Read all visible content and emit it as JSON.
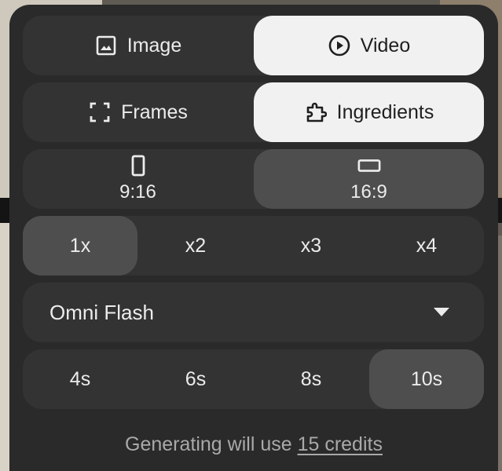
{
  "mode": {
    "image_label": "Image",
    "video_label": "Video",
    "selected": "Video",
    "image_icon": "image-icon",
    "video_icon": "play-circle-icon"
  },
  "input_type": {
    "frames_label": "Frames",
    "ingredients_label": "Ingredients",
    "selected": "Ingredients",
    "frames_icon": "frames-icon",
    "ingredients_icon": "puzzle-icon"
  },
  "aspect_ratio": {
    "portrait_label": "9:16",
    "landscape_label": "16:9",
    "selected": "16:9",
    "portrait_icon": "portrait-rect-icon",
    "landscape_icon": "landscape-rect-icon"
  },
  "count": {
    "options": [
      "1x",
      "x2",
      "x3",
      "x4"
    ],
    "selected": "1x"
  },
  "model": {
    "selected": "Omni Flash",
    "dropdown_icon": "caret-down-icon"
  },
  "duration": {
    "options": [
      "4s",
      "6s",
      "8s",
      "10s"
    ],
    "selected": "10s"
  },
  "footer": {
    "prefix": "Generating will use ",
    "credits_link": "15 credits"
  },
  "colors": {
    "panel": "#2a2a2a",
    "row": "#333333",
    "selected_light": "#f1f1f1",
    "selected_dark": "#4e4e4e",
    "text": "#ececec",
    "muted": "#a9a9a9"
  }
}
